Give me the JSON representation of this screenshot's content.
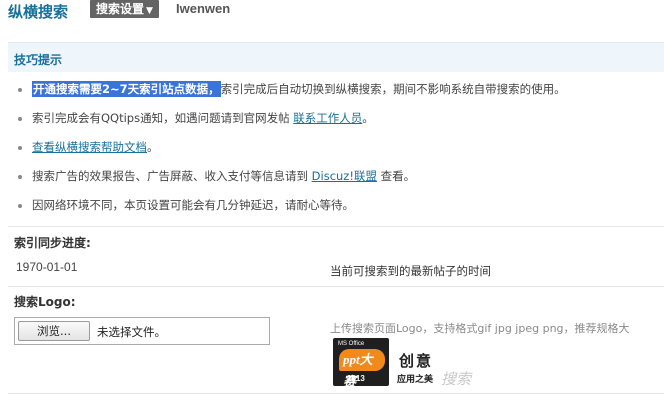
{
  "header": {
    "brand": "纵横搜索",
    "settings_label": "搜索设置",
    "settings_caret": "▼",
    "username": "Iwenwen"
  },
  "tips": {
    "title": "技巧提示",
    "items": [
      {
        "highlight": "开通搜索需要2~7天索引站点数据，",
        "text": "索引完成后自动切换到纵横搜索，期间不影响系统自带搜索的使用。"
      },
      {
        "text": "索引完成会有QQtips通知，如遇问题请到官网发帖 ",
        "link": "联系工作人员",
        "after": "。"
      },
      {
        "link": "查看纵横搜索帮助文档",
        "after": "。"
      },
      {
        "text": "搜索广告的效果报告、广告屏蔽、收入支付等信息请到 ",
        "link": "Discuz!联盟",
        "after": " 查看。"
      },
      {
        "text": "因网络环境不同，本页设置可能会有几分钟延迟，请耐心等待。"
      }
    ]
  },
  "index_progress": {
    "label": "索引同步进度:",
    "date": "1970-01-01",
    "description": "当前可搜索到的最新帖子的时间"
  },
  "search_logo": {
    "label": "搜索Logo:",
    "browse_label": "浏览...",
    "file_status": "未选择文件。",
    "hint": "上传搜索页面Logo，支持格式gif jpg jpeg png，推荐规格大",
    "logo_badge_top": "MS Office",
    "logo_badge_main": "ppt大赛",
    "logo_badge_year": "2013",
    "logo_title": "创意",
    "logo_subtitle": "应用之美",
    "logo_watermark": "搜索"
  },
  "colors": {
    "accent": "#19709a",
    "highlight_bg": "#3a74d6",
    "settings_bg": "#646464",
    "tips_bg": "#eef5fb"
  }
}
